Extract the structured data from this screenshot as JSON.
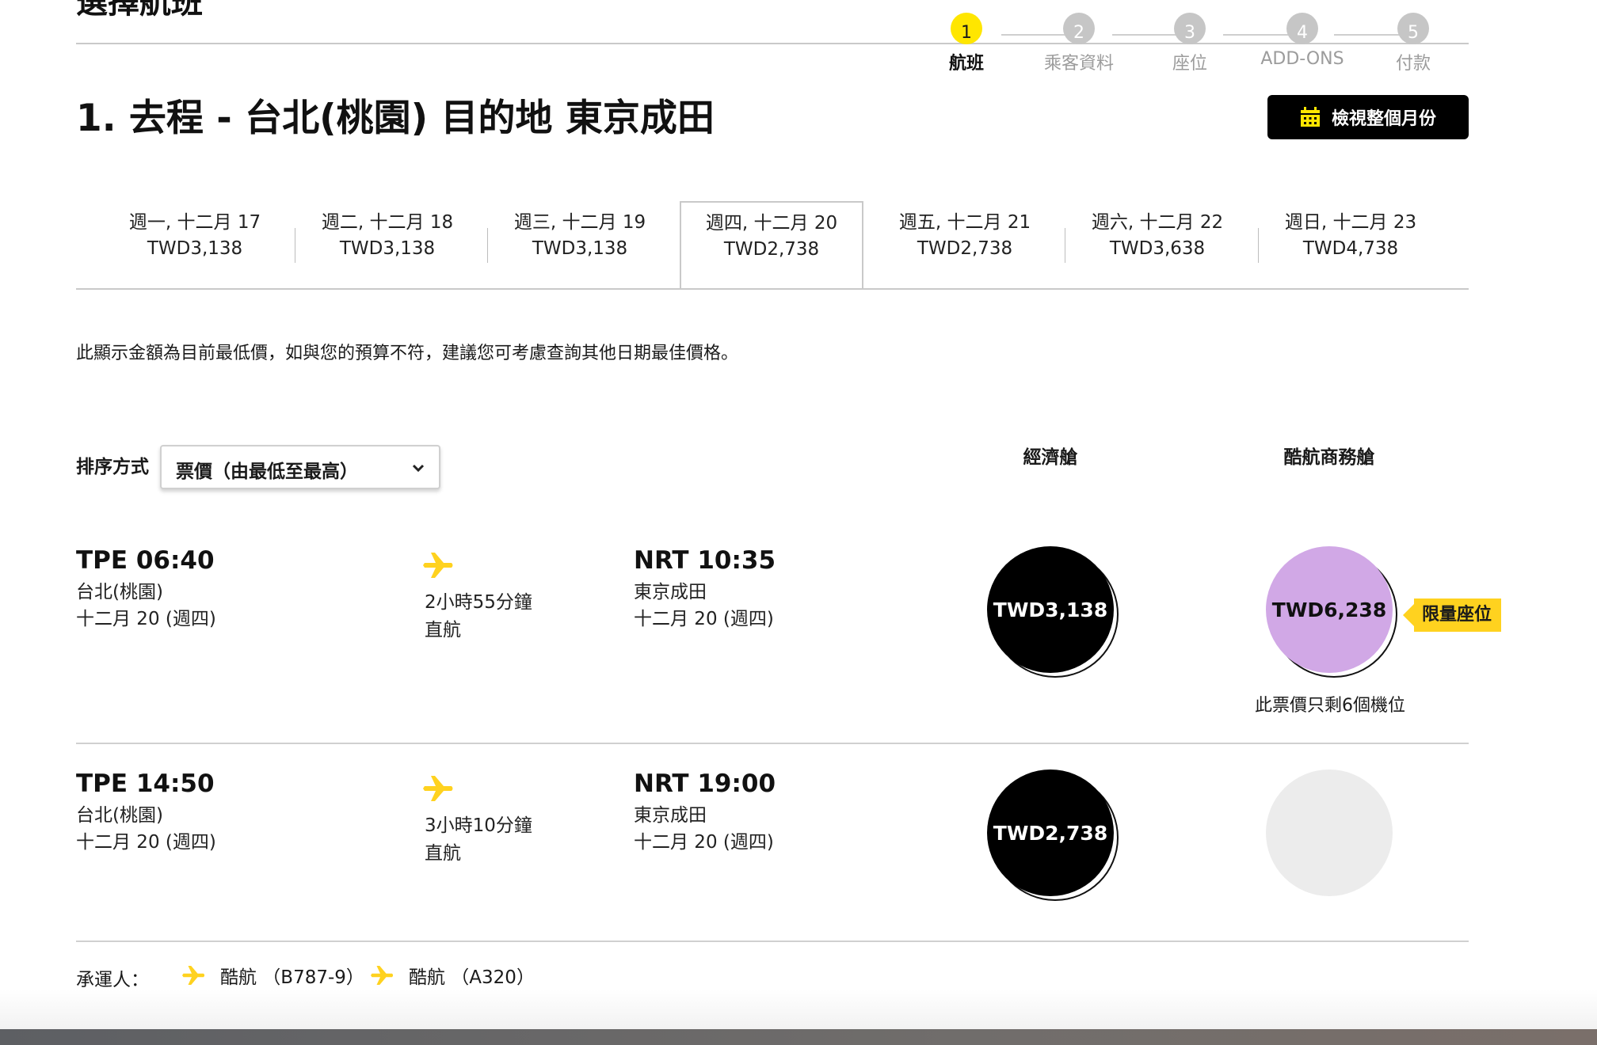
{
  "header": {
    "cut_heading": "選擇航班"
  },
  "stepper": [
    {
      "num": "1",
      "label": "航班",
      "active": true
    },
    {
      "num": "2",
      "label": "乘客資料",
      "active": false
    },
    {
      "num": "3",
      "label": "座位",
      "active": false
    },
    {
      "num": "4",
      "label": "ADD-ONS",
      "active": false
    },
    {
      "num": "5",
      "label": "付款",
      "active": false
    }
  ],
  "page_title": "1. 去程 - 台北(桃園) 目的地 東京成田",
  "month_button": {
    "label": "檢視整個月份",
    "icon": "calendar-icon"
  },
  "date_tabs": [
    {
      "day": "週一, 十二月 17",
      "price": "TWD3,138"
    },
    {
      "day": "週二, 十二月 18",
      "price": "TWD3,138"
    },
    {
      "day": "週三, 十二月 19",
      "price": "TWD3,138"
    },
    {
      "day": "週四, 十二月 20",
      "price": "TWD2,738"
    },
    {
      "day": "週五, 十二月 21",
      "price": "TWD2,738"
    },
    {
      "day": "週六, 十二月 22",
      "price": "TWD3,638"
    },
    {
      "day": "週日, 十二月 23",
      "price": "TWD4,738"
    }
  ],
  "selected_tab": "週四, 十二月 20",
  "notice": "此顯示金額為目前最低價，如與您的預算不符，建議您可考慮查詢其他日期最佳價格。",
  "sort": {
    "label": "排序方式",
    "value": "票價（由最低至最高）"
  },
  "columns": {
    "economy": "經濟艙",
    "business": "酷航商務艙"
  },
  "flights": [
    {
      "dep_time": "TPE 06:40",
      "dep_city": "台北(桃園)",
      "dep_date": "十二月 20 (週四)",
      "duration": "2小時55分鐘",
      "stops": "直航",
      "arr_time": "NRT 10:35",
      "arr_city": "東京成田",
      "arr_date": "十二月 20 (週四)",
      "economy_price": "TWD3,138",
      "business_price": "TWD6,238",
      "badge": "限量座位",
      "seats_left": "此票價只剩6個機位"
    },
    {
      "dep_time": "TPE 14:50",
      "dep_city": "台北(桃園)",
      "dep_date": "十二月 20 (週四)",
      "duration": "3小時10分鐘",
      "stops": "直航",
      "arr_time": "NRT 19:00",
      "arr_city": "東京成田",
      "arr_date": "十二月 20 (週四)",
      "economy_price": "TWD2,738",
      "business_price": ""
    }
  ],
  "carriers": {
    "label": "承運人：",
    "items": [
      "酷航 （B787-9）",
      "酷航 （A320）"
    ]
  },
  "colors": {
    "brand_yellow": "#ffe600",
    "badge_yellow": "#ffd21f",
    "business_lilac": "#d1a8e6",
    "inactive_grey": "#c6c6c6"
  }
}
